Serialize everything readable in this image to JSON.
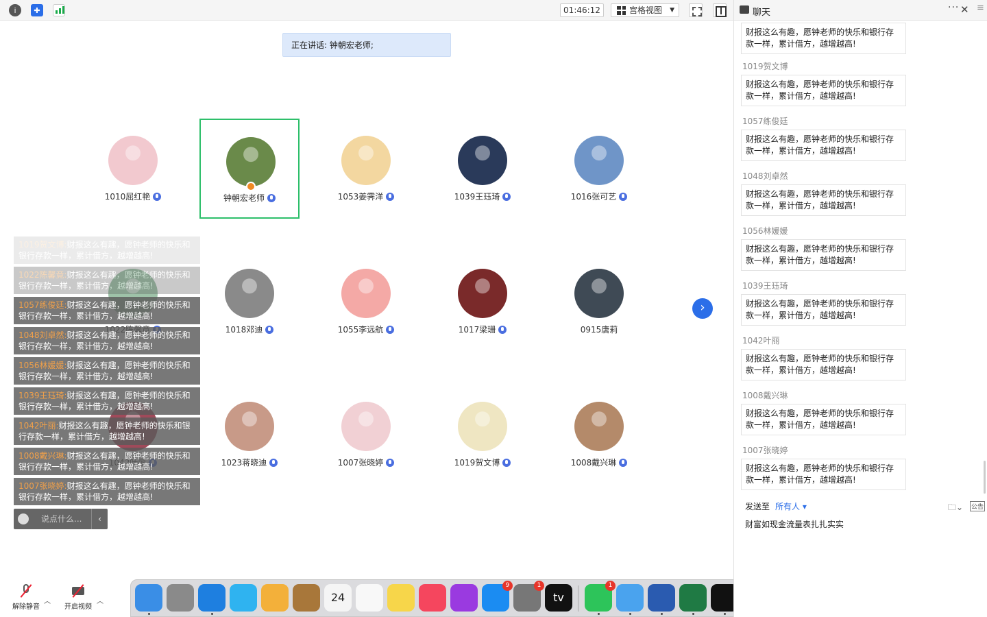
{
  "toolbar": {
    "timer": "01:46:12",
    "view_label": "宫格视图"
  },
  "speaking": "正在讲话: 钟朝宏老师;",
  "participants": [
    {
      "name": "1010屈红艳",
      "color": "#f2c9cf"
    },
    {
      "name": "钟朝宏老师",
      "color": "#6a8a4a",
      "host": true
    },
    {
      "name": "1053姜霁洋",
      "color": "#f3d7a0"
    },
    {
      "name": "1039王珏琦",
      "color": "#2a3a5a"
    },
    {
      "name": "1016张可艺",
      "color": "#6f95c8"
    },
    {
      "name": "1022陈馨竟",
      "color": "#9ec2a8"
    },
    {
      "name": "1018邓迪",
      "color": "#8a8a8a"
    },
    {
      "name": "1055李远航",
      "color": "#f4a9a6"
    },
    {
      "name": "1017梁珊",
      "color": "#7a2a2a"
    },
    {
      "name": "0915唐莉",
      "color": "#3f4a55"
    },
    {
      "name": "1042叶丽",
      "color": "#a04a5a"
    },
    {
      "name": "1023蒋晓迪",
      "color": "#c89a88"
    },
    {
      "name": "1007张晓婷",
      "color": "#f1d0d4"
    },
    {
      "name": "1019贺文博",
      "color": "#efe6c2"
    },
    {
      "name": "1008戴兴琳",
      "color": "#b48a6a"
    }
  ],
  "bullets": [
    {
      "who": "1019贺文博:",
      "text": "财报这么有趣，愿钟老师的快乐和银行存款一样，累计借方，越增越高!"
    },
    {
      "who": "1022陈馨竟:",
      "text": "财报这么有趣，愿钟老师的快乐和银行存款一样，累计借方，越增越高!"
    },
    {
      "who": "1057练俊廷:",
      "text": "财报这么有趣，愿钟老师的快乐和银行存款一样，累计借方，越增越高!"
    },
    {
      "who": "1048刘卓然:",
      "text": "财报这么有趣，愿钟老师的快乐和银行存款一样，累计借方，越增越高!"
    },
    {
      "who": "1056林媛媛:",
      "text": "财报这么有趣，愿钟老师的快乐和银行存款一样，累计借方，越增越高!"
    },
    {
      "who": "1039王珏琦:",
      "text": "财报这么有趣，愿钟老师的快乐和银行存款一样，累计借方，越增越高!"
    },
    {
      "who": "1042叶丽:",
      "text": "财报这么有趣，愿钟老师的快乐和银行存款一样，累计借方，越增越高!"
    },
    {
      "who": "1008戴兴琳:",
      "text": "财报这么有趣，愿钟老师的快乐和银行存款一样，累计借方，越增越高!"
    },
    {
      "who": "1007张晓婷:",
      "text": "财报这么有趣，愿钟老师的快乐和银行存款一样，累计借方，越增越高!"
    }
  ],
  "say_placeholder": "说点什么...",
  "controls": {
    "mute": "解除静音",
    "video": "开启视频"
  },
  "dock": [
    {
      "icon": "finder-icon",
      "color": "#3a8ee6",
      "dot": true
    },
    {
      "icon": "launchpad-icon",
      "color": "#8a8a8a"
    },
    {
      "icon": "safari-icon",
      "color": "#1e7fe0",
      "dot": true
    },
    {
      "icon": "messages-icon",
      "color": "#2fb3f0"
    },
    {
      "icon": "photos-icon",
      "color": "#f3b03a"
    },
    {
      "icon": "contacts-icon",
      "color": "#a8773a"
    },
    {
      "icon": "calendar-icon",
      "color": "#f5f5f5",
      "text": "24"
    },
    {
      "icon": "reminders-icon",
      "color": "#f8f8f8"
    },
    {
      "icon": "notes-icon",
      "color": "#f7d64a"
    },
    {
      "icon": "music-icon",
      "color": "#f5465e"
    },
    {
      "icon": "podcasts-icon",
      "color": "#9a3ae0"
    },
    {
      "icon": "app-store-icon",
      "color": "#1b8cf2",
      "badge": "9"
    },
    {
      "icon": "system-settings-icon",
      "color": "#777",
      "badge": "1"
    },
    {
      "icon": "apple-tv-icon",
      "color": "#111",
      "text": "tv"
    },
    {
      "icon": "wechat-icon",
      "color": "#2dc45a",
      "badge": "1",
      "dot": true
    },
    {
      "icon": "dingtalk-icon",
      "color": "#4aa3ee",
      "dot": true
    },
    {
      "icon": "word-icon",
      "color": "#2a5bb0",
      "dot": true
    },
    {
      "icon": "excel-icon",
      "color": "#1f7a44",
      "dot": true
    },
    {
      "icon": "qq-icon",
      "color": "#111",
      "dot": true
    },
    {
      "icon": "lark-icon",
      "color": "#2468e8",
      "dot": true
    },
    {
      "icon": "downloads-icon",
      "color": "#e8e8ee"
    },
    {
      "icon": "trash-icon",
      "color": "#d9d9dc"
    }
  ],
  "chat": {
    "title": "聊天",
    "first_message": "财报这么有趣，愿钟老师的快乐和银行存款一样，累计借方，越增越高!",
    "messages": [
      {
        "sender": "1019贺文博",
        "text": "财报这么有趣，愿钟老师的快乐和银行存款一样，累计借方，越增越高!"
      },
      {
        "sender": "1057练俊廷",
        "text": "财报这么有趣，愿钟老师的快乐和银行存款一样，累计借方，越增越高!"
      },
      {
        "sender": "1048刘卓然",
        "text": "财报这么有趣，愿钟老师的快乐和银行存款一样，累计借方，越增越高!"
      },
      {
        "sender": "1056林媛媛",
        "text": "财报这么有趣，愿钟老师的快乐和银行存款一样，累计借方，越增越高!"
      },
      {
        "sender": "1039王珏琦",
        "text": "财报这么有趣，愿钟老师的快乐和银行存款一样，累计借方，越增越高!"
      },
      {
        "sender": "1042叶丽",
        "text": "财报这么有趣，愿钟老师的快乐和银行存款一样，累计借方，越增越高!"
      },
      {
        "sender": "1008戴兴琳",
        "text": "财报这么有趣，愿钟老师的快乐和银行存款一样，累计借方，越增越高!"
      },
      {
        "sender": "1007张晓婷",
        "text": "财报这么有趣，愿钟老师的快乐和银行存款一样，累计借方，越增越高!"
      }
    ],
    "send_to_label": "发送至",
    "send_to_target": "所有人",
    "public_label": "公告",
    "input_value": "财富如现金流量表扎扎实实"
  }
}
